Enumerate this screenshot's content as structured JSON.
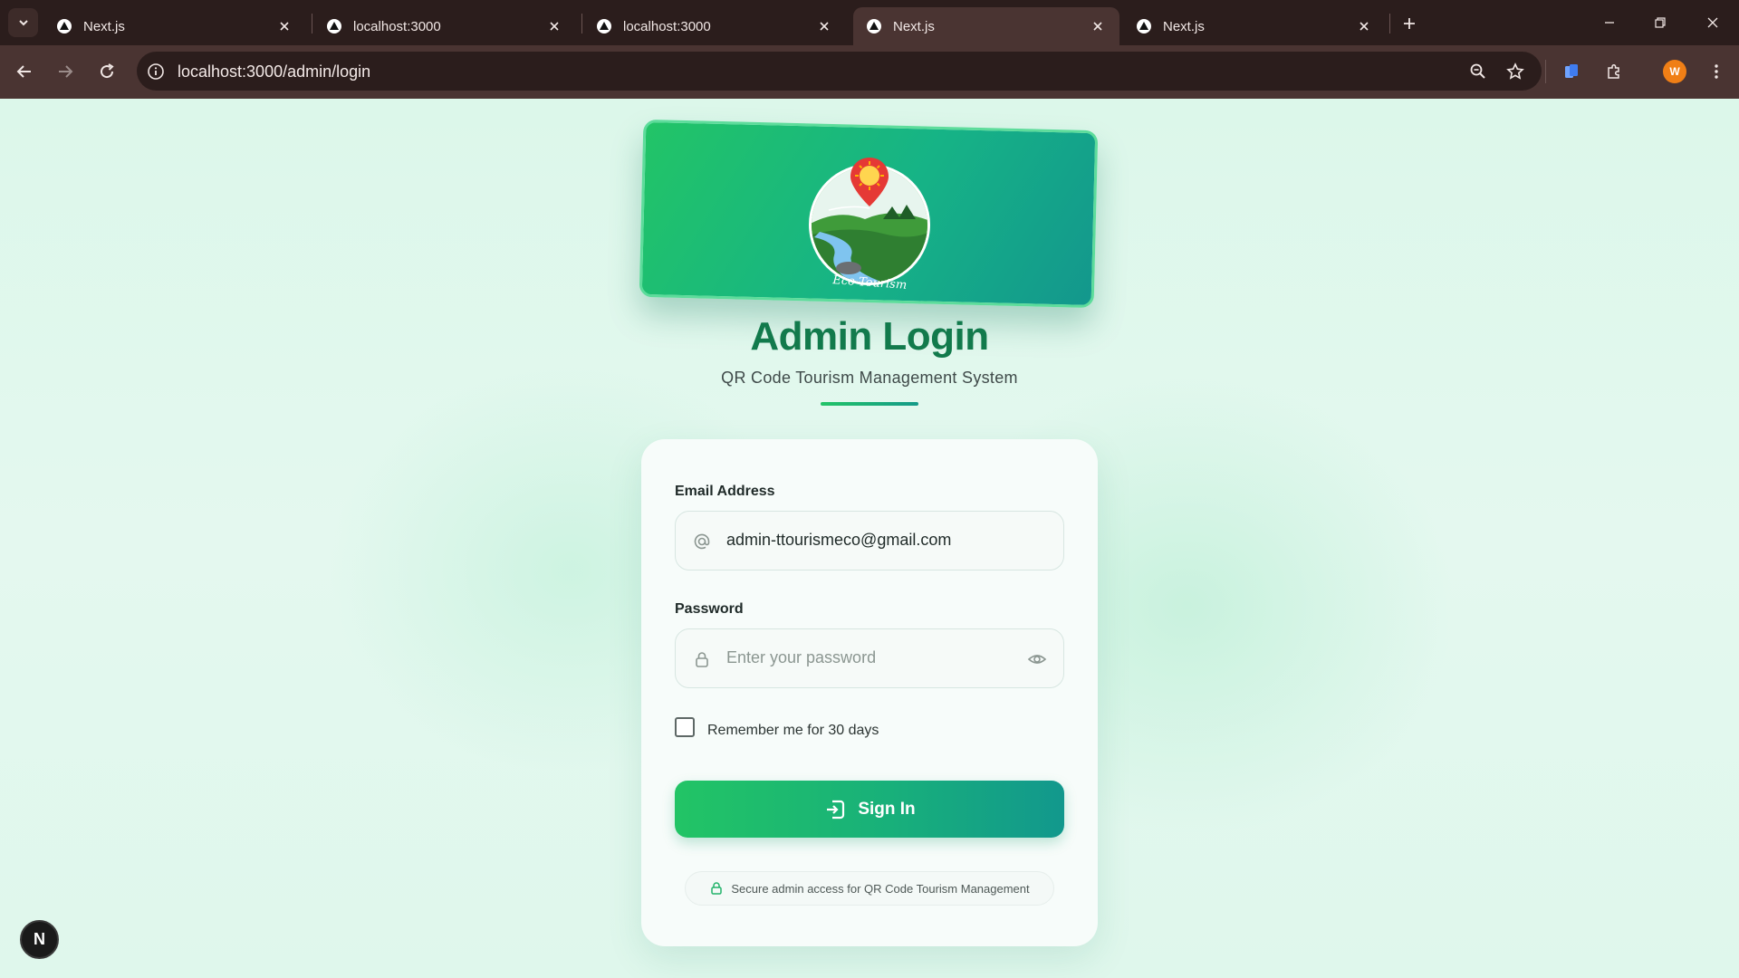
{
  "browser": {
    "tabs": [
      {
        "title": "Next.js",
        "favicon": "nextjs-triangle-icon",
        "active": false
      },
      {
        "title": "localhost:3000",
        "favicon": "nextjs-triangle-icon",
        "active": false
      },
      {
        "title": "localhost:3000",
        "favicon": "nextjs-triangle-icon",
        "active": false
      },
      {
        "title": "Next.js",
        "favicon": "nextjs-triangle-icon",
        "active": true
      },
      {
        "title": "Next.js",
        "favicon": "nextjs-triangle-icon",
        "active": false
      }
    ],
    "url": "localhost:3000/admin/login",
    "profile_initial": "W",
    "colors": {
      "frame": "#2b1d1c",
      "toolbar": "#4a3432",
      "profile": "#f07f16"
    }
  },
  "logo": {
    "caption": "Eco Tourism"
  },
  "header": {
    "title": "Admin Login",
    "subtitle": "QR Code Tourism Management System"
  },
  "form": {
    "email_label": "Email Address",
    "email_value": "admin-ttourismeco@gmail.com",
    "email_icon": "at-sign-icon",
    "password_label": "Password",
    "password_placeholder": "Enter your password",
    "password_icon": "lock-icon",
    "toggle_icon": "eye-icon",
    "remember_label": "Remember me for 30 days",
    "remember_checked": false,
    "submit_label": "Sign In",
    "submit_icon": "login-icon",
    "secure_note": "Secure admin access for QR Code Tourism Management"
  },
  "dev_indicator": {
    "label": "N"
  },
  "colors": {
    "accent_green": "#22c465",
    "accent_teal": "#12988d",
    "title_green": "#127a4c",
    "page_bg": "#dff7ec"
  }
}
